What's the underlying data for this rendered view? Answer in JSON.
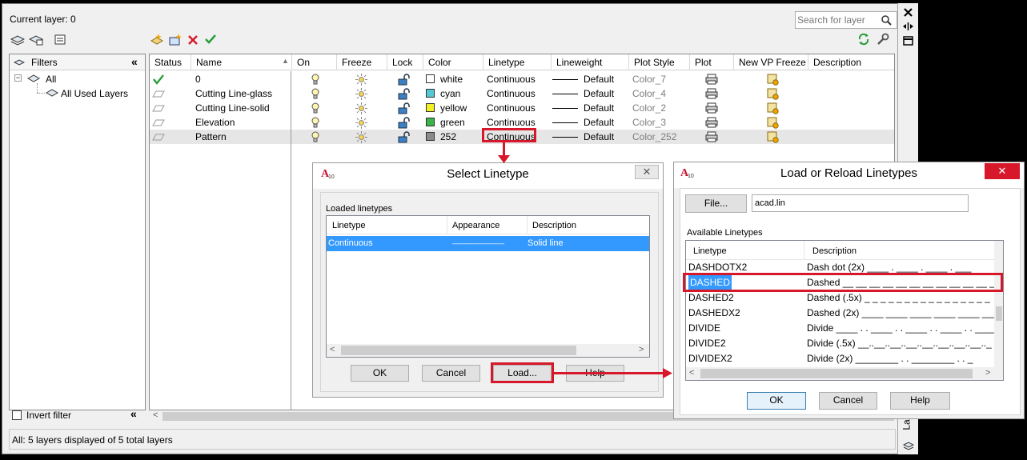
{
  "layer_manager": {
    "current_layer": "Current layer: 0",
    "search_placeholder": "Search for layer",
    "filters_header": "Filters",
    "tree": [
      "All",
      "All Used Layers"
    ],
    "invert_filter": "Invert filter",
    "status_bar": "All: 5 layers displayed of 5 total layers",
    "side_label": "La",
    "columns": [
      "Status",
      "Name",
      "On",
      "Freeze",
      "Lock",
      "Color",
      "Linetype",
      "Lineweight",
      "Plot Style",
      "Plot",
      "New VP Freeze",
      "Description"
    ],
    "rows": [
      {
        "name": "0",
        "color": "white",
        "swatch": "#ffffff",
        "linetype": "Continuous",
        "lineweight": "Default",
        "plot_style": "Color_7",
        "current": true
      },
      {
        "name": "Cutting Line-glass",
        "color": "cyan",
        "swatch": "#55c8d8",
        "linetype": "Continuous",
        "lineweight": "Default",
        "plot_style": "Color_4",
        "current": false
      },
      {
        "name": "Cutting Line-solid",
        "color": "yellow",
        "swatch": "#f2ef22",
        "linetype": "Continuous",
        "lineweight": "Default",
        "plot_style": "Color_2",
        "current": false
      },
      {
        "name": "Elevation",
        "color": "green",
        "swatch": "#39b54a",
        "linetype": "Continuous",
        "lineweight": "Default",
        "plot_style": "Color_3",
        "current": false
      },
      {
        "name": "Pattern",
        "color": "252",
        "swatch": "#8a8a8a",
        "linetype": "Continuous",
        "lineweight": "Default",
        "plot_style": "Color_252",
        "current": false
      }
    ]
  },
  "select_linetype": {
    "title": "Select Linetype",
    "group_label": "Loaded linetypes",
    "columns": [
      "Linetype",
      "Appearance",
      "Description"
    ],
    "rows": [
      {
        "linetype": "Continuous",
        "appearance": "————————",
        "description": "Solid line"
      }
    ],
    "buttons": {
      "ok": "OK",
      "cancel": "Cancel",
      "load": "Load...",
      "help": "Help"
    }
  },
  "load_linetypes": {
    "title": "Load or Reload Linetypes",
    "file_button": "File...",
    "file_value": "acad.lin",
    "group_label": "Available Linetypes",
    "columns": [
      "Linetype",
      "Description"
    ],
    "rows": [
      {
        "name": "DASHDOTX2",
        "desc": "Dash dot (2x) ____ . ____ . ____ . ___"
      },
      {
        "name": "DASHED",
        "desc": "Dashed __ __ __ __ __ __ __ __ __ __ __ __ __ __"
      },
      {
        "name": "DASHED2",
        "desc": "Dashed (.5x) _ _ _ _ _ _ _ _ _ _ _ _ _ _ _ _"
      },
      {
        "name": "DASHEDX2",
        "desc": "Dashed (2x) ____ ____ ____ ____ ____ ___"
      },
      {
        "name": "DIVIDE",
        "desc": "Divide ____ . . ____ . . ____ . . ____ . . ____"
      },
      {
        "name": "DIVIDE2",
        "desc": "Divide (.5x) __..__..__..__..__..__..__..__.._"
      },
      {
        "name": "DIVIDEX2",
        "desc": "Divide (2x) ________ . . ________ . . _"
      }
    ],
    "buttons": {
      "ok": "OK",
      "cancel": "Cancel",
      "help": "Help"
    }
  },
  "colors": {
    "highlight": "#3399ff",
    "annotation": "#d7182a"
  }
}
